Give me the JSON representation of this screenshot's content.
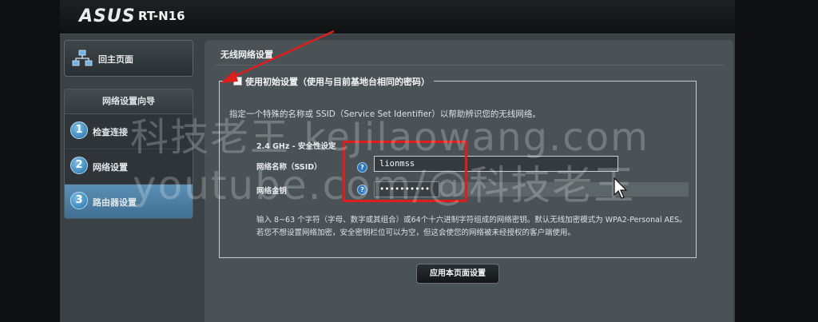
{
  "header": {
    "logo": "ASUS",
    "model": "RT-N16"
  },
  "sidebar": {
    "home_label": "回主页面",
    "home_icon": "network-icon",
    "wizard_title": "网络设置向导",
    "steps": [
      {
        "num": "1",
        "label": "检查连接"
      },
      {
        "num": "2",
        "label": "网络设置"
      },
      {
        "num": "3",
        "label": "路由器设置"
      }
    ],
    "active_step": 3
  },
  "panel": {
    "title": "无线网络设置",
    "legend_checkbox_label": "使用初始设置（使用与目前基地台相同的密码）",
    "legend_checked": false,
    "description": "指定一个特殊的名称或 SSID（Service Set Identifier）以帮助辨识您的无线网络。",
    "band_label": "2.4 GHz - 安全性设定",
    "ssid_label": "网络名称（SSID）",
    "ssid_value": "lionmss",
    "key_label": "网络金钥",
    "key_value": "••••••••••",
    "help_glyph": "?",
    "note": "输入 8~63 个字符（字母、数字或其组合）或64个十六进制字符组成的网络密钥。默认无线加密模式为 WPA2-Personal AES。若您不想设置网络加密，安全密钥栏位可以为空，但这会使您的网络被未经授权的客户端使用。",
    "apply_label": "应用本页面设置"
  },
  "watermark": {
    "line1": "科技老王 keJilaowang.com",
    "line2": "youtube.com/@科技老王"
  },
  "colors": {
    "annotation_red": "#e01d1d",
    "active_step": "#4f84a8",
    "help_blue": "#2f78c0"
  }
}
